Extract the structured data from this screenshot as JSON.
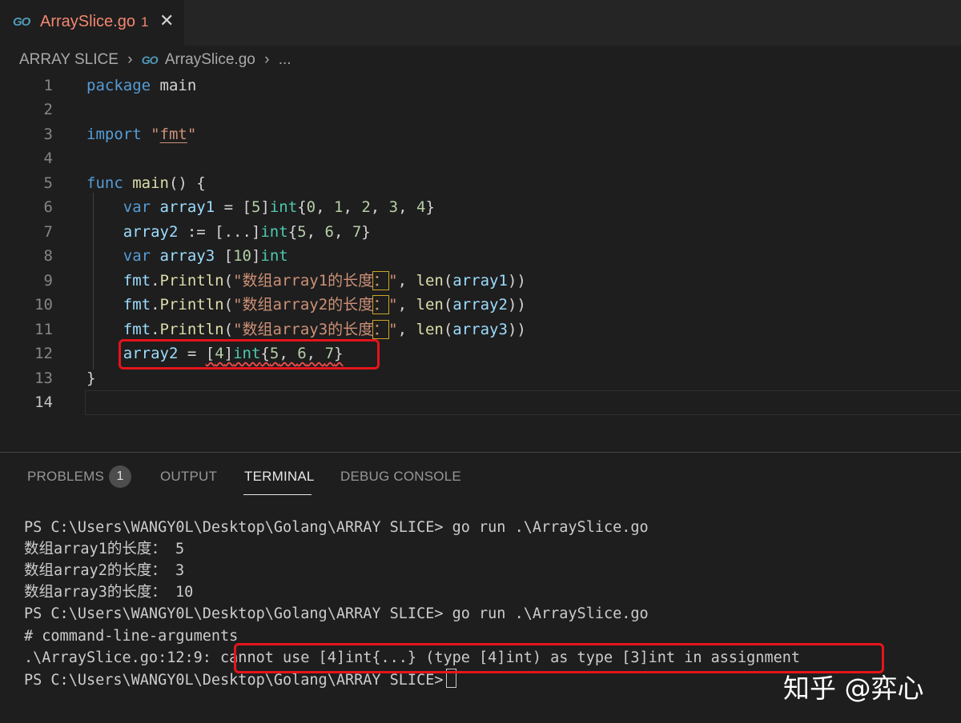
{
  "tab": {
    "logo": "GO",
    "title": "ArraySlice.go",
    "problem_count": "1",
    "close": "✕"
  },
  "breadcrumb": {
    "folder": "ARRAY SLICE",
    "sep": "›",
    "logo": "GO",
    "file": "ArraySlice.go",
    "more": "..."
  },
  "editor": {
    "line_numbers": [
      "1",
      "2",
      "3",
      "4",
      "5",
      "6",
      "7",
      "8",
      "9",
      "10",
      "11",
      "12",
      "13",
      "14"
    ],
    "tokens": {
      "package": "package",
      "main": "main",
      "import": "import",
      "fmt_quote1": "\"",
      "fmt": "fmt",
      "fmt_quote2": "\"",
      "func": "func",
      "main_fn": "main",
      "main_paren": "() {",
      "l6_var": "var",
      "l6_name": "array1",
      "l6_eq": " = [",
      "l6_len": "5",
      "l6_br": "]",
      "l6_type": "int",
      "l6_vals_open": "{",
      "l6_v0": "0",
      "l6_v1": "1",
      "l6_v2": "2",
      "l6_v3": "3",
      "l6_v4": "4",
      "l6_close": "}",
      "comma": ", ",
      "l7_name": "array2",
      "l7_op": " := [...]",
      "l7_type": "int",
      "l7_open": "{",
      "l7_v0": "5",
      "l7_v1": "6",
      "l7_v2": "7",
      "l7_close": "}",
      "l8_var": "var",
      "l8_name": "array3",
      "l8_open": " [",
      "l8_len": "10",
      "l8_close": "]",
      "l8_type": "int",
      "fmt_pkg": "fmt",
      "dot": ".",
      "println": "Println",
      "paren_open": "(",
      "l9_str": "\"数组array1的长度",
      "colon": "：",
      "quote_end": "\"",
      "len": "len",
      "l9_arg": "array1",
      "paren_close2": "))",
      "l10_str": "\"数组array2的长度",
      "l10_arg": "array2",
      "l11_str": "\"数组array3的长度",
      "l11_arg": "array3",
      "l12_name": "array2",
      "l12_eq": " = ",
      "l12_lit_a": "[",
      "l12_lit_len": "4",
      "l12_lit_b": "]",
      "l12_type": "int",
      "l12_lit_c": "{",
      "l12_v0": "5",
      "l12_v1": "6",
      "l12_v2": "7",
      "l12_lit_d": "}",
      "close_brace": "}"
    }
  },
  "panel": {
    "tabs": {
      "problems": "PROBLEMS",
      "output": "OUTPUT",
      "terminal": "TERMINAL",
      "debug": "DEBUG CONSOLE"
    },
    "problems_badge": "1"
  },
  "terminal": {
    "lines": [
      "PS C:\\Users\\WANGY0L\\Desktop\\Golang\\ARRAY SLICE> go run .\\ArraySlice.go",
      "数组array1的长度： 5",
      "数组array2的长度： 3",
      "数组array3的长度： 10",
      "PS C:\\Users\\WANGY0L\\Desktop\\Golang\\ARRAY SLICE> go run .\\ArraySlice.go",
      "# command-line-arguments",
      ".\\ArraySlice.go:12:9: cannot use [4]int{...} (type [4]int) as type [3]int in assignment",
      "PS C:\\Users\\WANGY0L\\Desktop\\Golang\\ARRAY SLICE>"
    ]
  },
  "watermark": "知乎 @弈心",
  "colors": {
    "accent_red": "#e5141b",
    "error": "#f48771",
    "keyword": "#569cd6",
    "string": "#ce9178",
    "type": "#4ec9b0"
  }
}
